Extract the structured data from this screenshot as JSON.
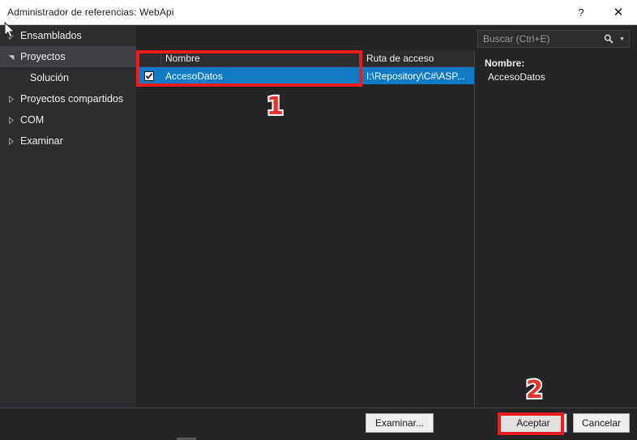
{
  "window": {
    "title": "Administrador de referencias: WebApi",
    "help_label": "?",
    "close_label": "✕"
  },
  "sidebar": {
    "items": [
      {
        "label": "Ensamblados",
        "twisty": "chevron-right-icon",
        "selected": false,
        "child": false
      },
      {
        "label": "Proyectos",
        "twisty": "chevron-down-icon",
        "selected": true,
        "child": false
      },
      {
        "label": "Solución",
        "twisty": "none",
        "selected": false,
        "child": true
      },
      {
        "label": "Proyectos compartidos",
        "twisty": "chevron-right-icon",
        "selected": false,
        "child": false
      },
      {
        "label": "COM",
        "twisty": "chevron-right-icon",
        "selected": false,
        "child": false
      },
      {
        "label": "Examinar",
        "twisty": "chevron-right-icon",
        "selected": false,
        "child": false
      }
    ]
  },
  "search": {
    "placeholder": "Buscar (Ctrl+E)",
    "value": "",
    "icon": "search-icon",
    "dropdown_icon": "chevron-down-icon"
  },
  "list": {
    "columns": [
      "",
      "Nombre",
      "Ruta de acceso"
    ],
    "rows": [
      {
        "checked": true,
        "name": "AccesoDatos",
        "path": "I:\\Repository\\C#\\ASP...",
        "selected": true
      }
    ]
  },
  "detail": {
    "name_label": "Nombre:",
    "name_value": "AccesoDatos"
  },
  "footer": {
    "examinar_label": "Examinar...",
    "aceptar_label": "Aceptar",
    "cancelar_label": "Cancelar"
  },
  "annotations": {
    "marker_one": "1",
    "marker_two": "2",
    "color": "#ee1c1c"
  },
  "colors": {
    "selection_blue": "#0e7bc4",
    "panel_bg": "#252526",
    "sidebar_bg": "#2d2d30",
    "titlebar_bg": "#ffffff",
    "annotation_red": "#ee1c1c"
  }
}
